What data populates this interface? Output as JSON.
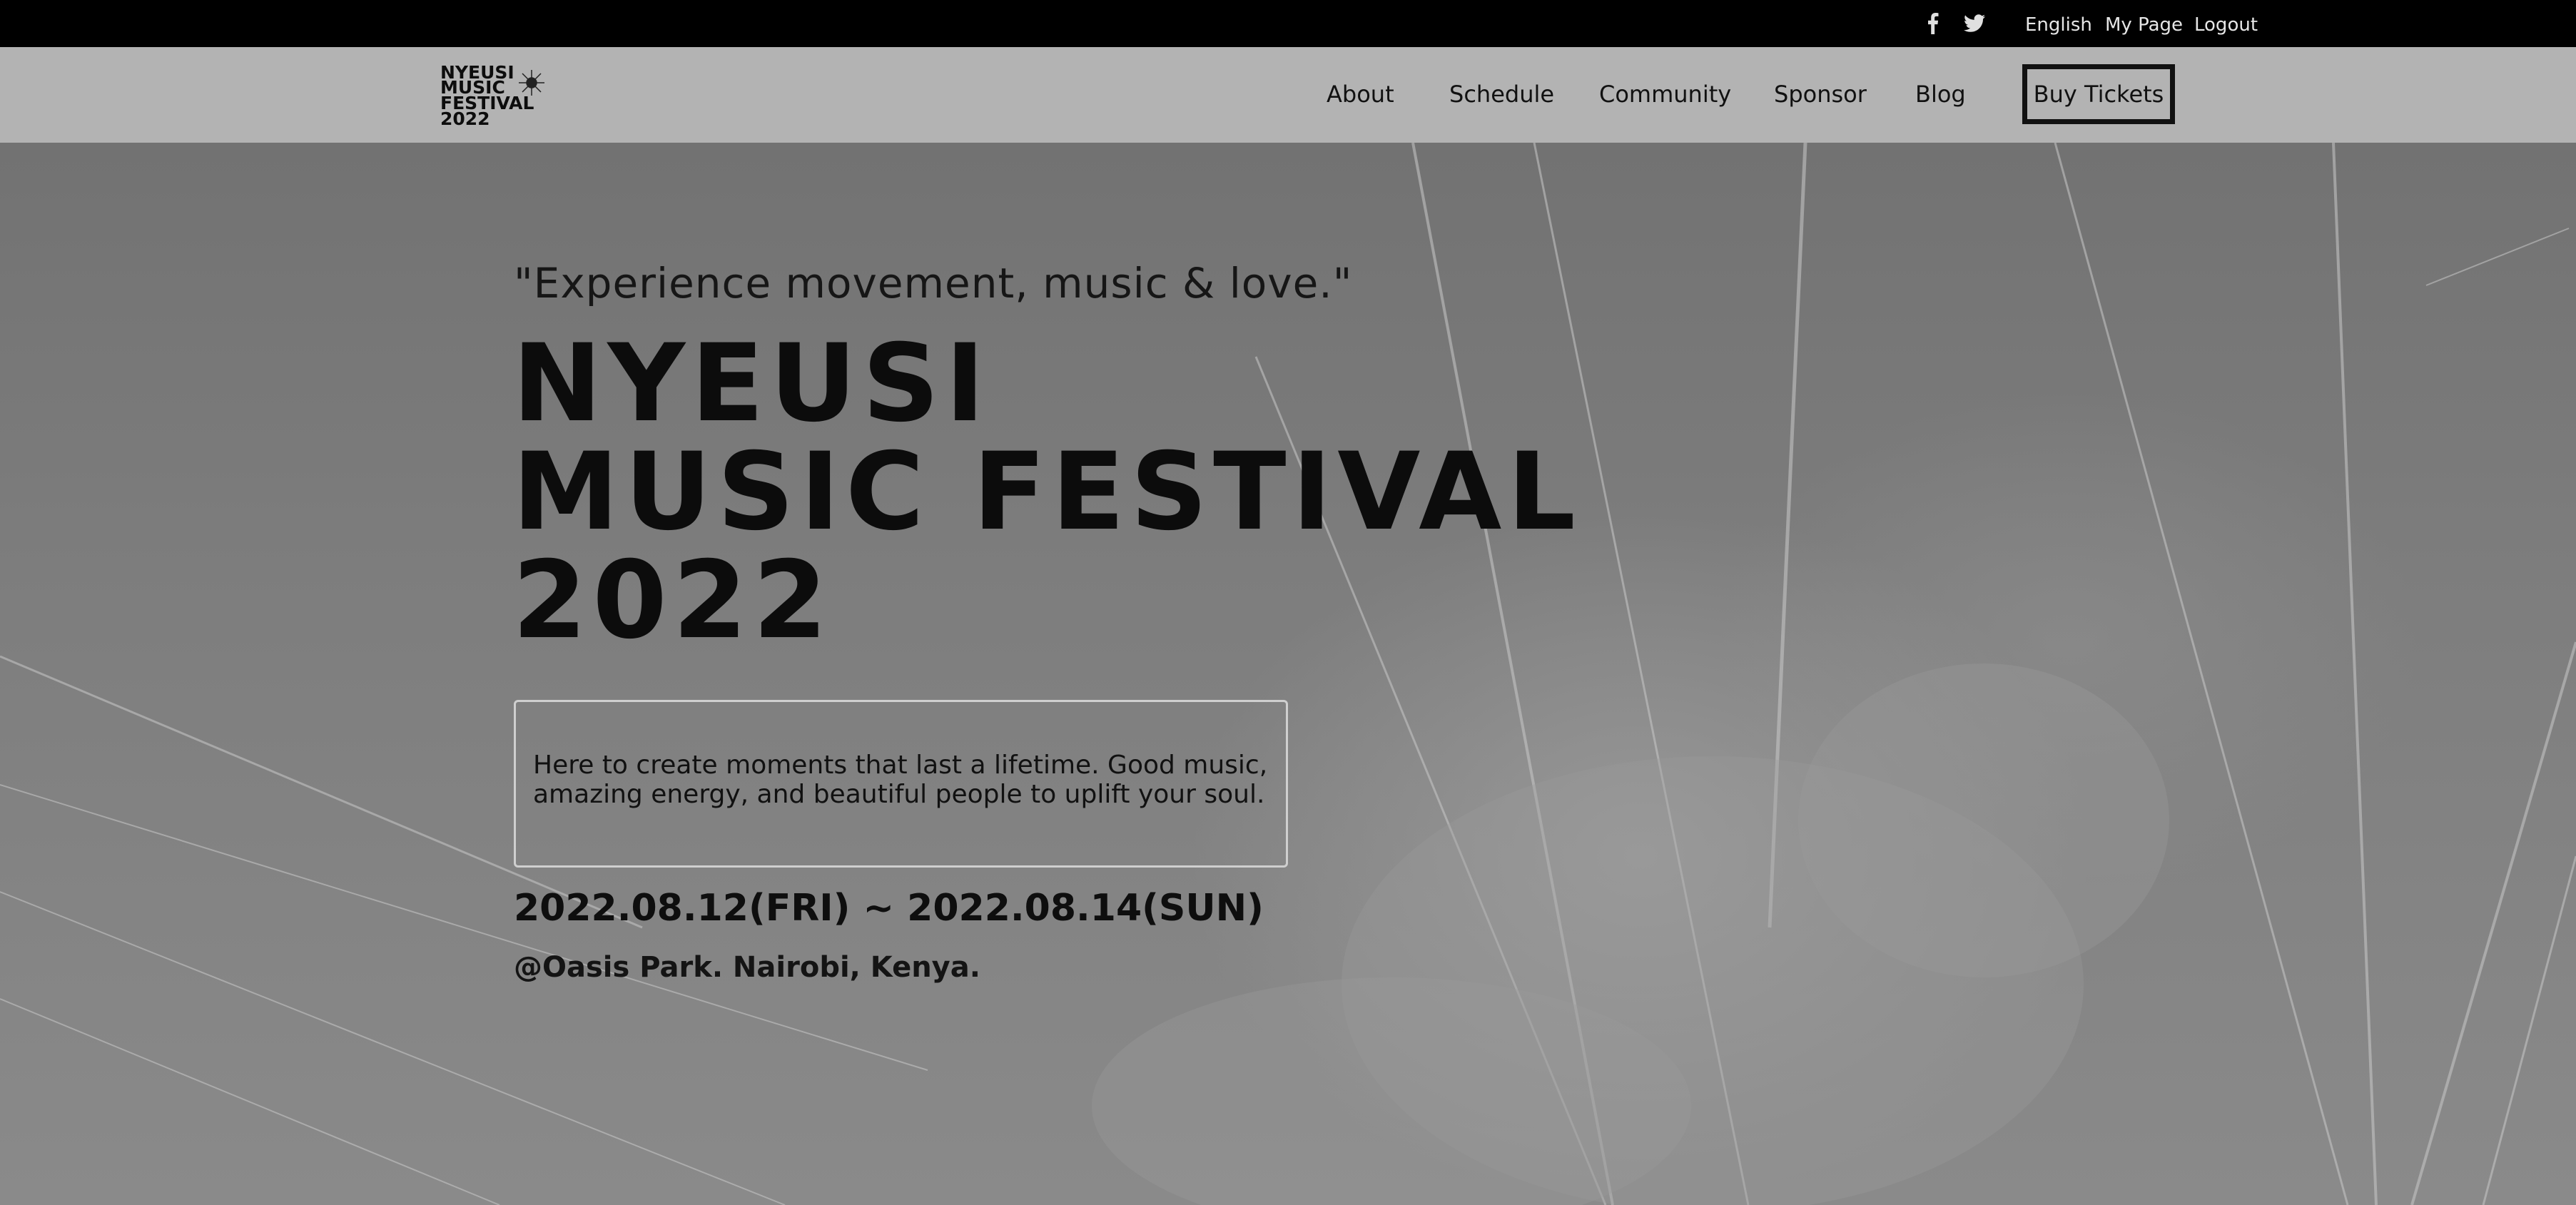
{
  "topbar": {
    "social": [
      "facebook-icon",
      "twitter-icon"
    ],
    "links": [
      "English",
      "My Page",
      "Logout"
    ]
  },
  "logo": {
    "lines": [
      "NYEUSI",
      "MUSIC",
      "FESTIVAL",
      "2022"
    ]
  },
  "nav": {
    "items": [
      "About",
      "Schedule",
      "Community",
      "Sponsor",
      "Blog"
    ],
    "cta": "Buy Tickets"
  },
  "hero": {
    "tagline": "\"Experience movement, music & love.\"",
    "title_lines": [
      "NYEUSI",
      "MUSIC FESTIVAL",
      "2022"
    ],
    "description": "Here to create moments that last a lifetime. Good music, amazing energy, and beautiful people to uplift your soul.",
    "dates": "2022.08.12(FRI) ~ 2022.08.14(SUN)",
    "venue": "@Oasis Park. Nairobi, Kenya."
  },
  "colors": {
    "topbar_bg": "#000000",
    "navbar_bg": "#b3b3b3",
    "hero_bg": "#7a7a7a",
    "text_dark": "#111111"
  }
}
